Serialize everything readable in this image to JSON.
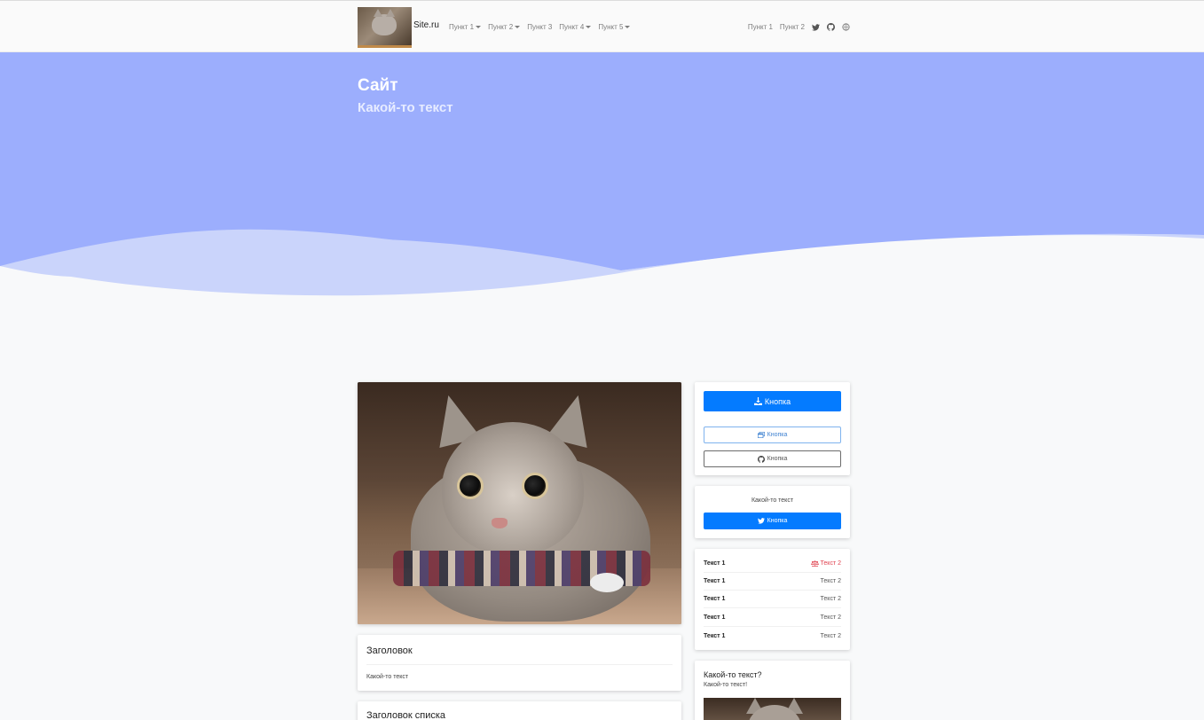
{
  "navbar": {
    "brand": "Site.ru",
    "menu": [
      {
        "label": "Пункт 1",
        "dropdown": true
      },
      {
        "label": "Пункт 2",
        "dropdown": true
      },
      {
        "label": "Пункт 3",
        "dropdown": false
      },
      {
        "label": "Пункт 4",
        "dropdown": true
      },
      {
        "label": "Пункт 5",
        "dropdown": true
      }
    ],
    "right_menu": [
      "Пункт 1",
      "Пункт 2"
    ],
    "right_icons": [
      "twitter-icon",
      "github-icon",
      "globe-icon"
    ]
  },
  "hero": {
    "title": "Сайт",
    "subtitle": "Какой-то текст",
    "colors": {
      "background": "#9caefd",
      "wave_light": "#cad4fb",
      "page": "#f8f9fa"
    }
  },
  "main": {
    "card_title": {
      "heading": "Заголовок",
      "text": "Какой-то текст"
    },
    "card_list": {
      "heading": "Заголовок списка"
    }
  },
  "sidebar": {
    "buttons": [
      {
        "label": "Кнопка",
        "icon": "download-icon",
        "style": "primary"
      },
      {
        "label": "Кнопка",
        "icon": "window-icon",
        "style": "outline-info"
      },
      {
        "label": "Кнопка",
        "icon": "github-icon",
        "style": "outline-dark"
      }
    ],
    "twitter_card": {
      "text": "Какой-то текст",
      "button": "Кнопка",
      "icon": "twitter-icon"
    },
    "table": [
      {
        "left": "Текст 1",
        "right": "Текст 2",
        "icon": "scales-icon",
        "highlight": true
      },
      {
        "left": "Текст 1",
        "right": "Текст 2"
      },
      {
        "left": "Текст 1",
        "right": "Текст 2"
      },
      {
        "left": "Текст 1",
        "right": "Текст 2"
      },
      {
        "left": "Текст 1",
        "right": "Текст 2"
      }
    ],
    "promo": {
      "heading": "Какой-то текст?",
      "text": "Какой-то текст!"
    }
  },
  "colors": {
    "primary": "#047bff",
    "danger": "#e0424f",
    "info": "#3f82d1"
  }
}
